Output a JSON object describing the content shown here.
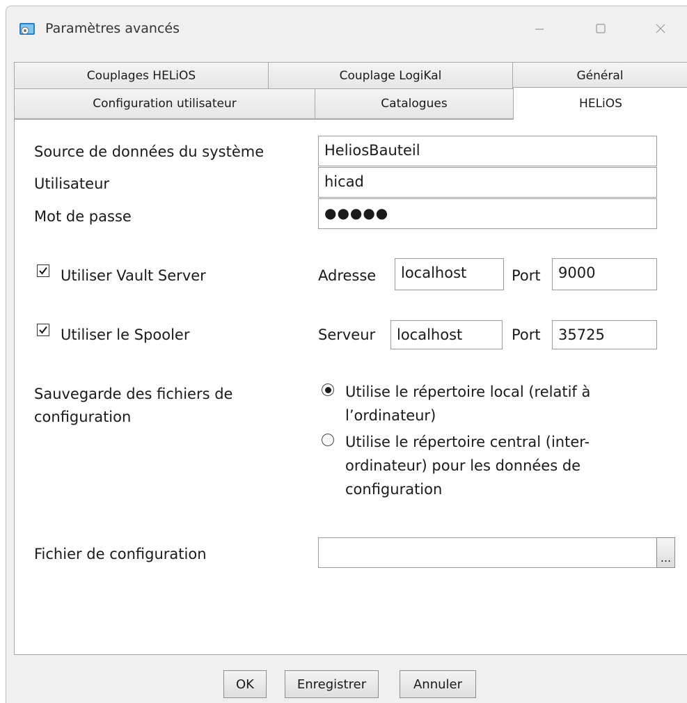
{
  "window": {
    "title": "Paramètres avancés",
    "icon": "settings-app-icon"
  },
  "tabs": {
    "row1": [
      {
        "label": "Couplages HELiOS"
      },
      {
        "label": "Couplage LogiKal"
      },
      {
        "label": "Général"
      }
    ],
    "row2": [
      {
        "label": "Configuration utilisateur"
      },
      {
        "label": "Catalogues"
      },
      {
        "label": "HELiOS",
        "active": true
      }
    ]
  },
  "form": {
    "datasource_label": "Source de données du système",
    "datasource_value": "HeliosBauteil",
    "user_label": "Utilisateur",
    "user_value": "hicad",
    "password_label": "Mot de passe",
    "password_value": "●●●●●",
    "vault": {
      "checked": true,
      "label": "Utiliser Vault Server",
      "address_label": "Adresse",
      "address_value": "localhost",
      "port_label": "Port",
      "port_value": "9000"
    },
    "spooler": {
      "checked": true,
      "label": "Utiliser le Spooler",
      "server_label": "Serveur",
      "server_value": "localhost",
      "port_label": "Port",
      "port_value": "35725"
    },
    "config_save_label_1": "Sauvegarde des fichiers de",
    "config_save_label_2": "configuration",
    "radio_local_1": "Utilise le répertoire local (relatif à",
    "radio_local_2": "l’ordinateur)",
    "radio_local_selected": true,
    "radio_central_1": "Utilise le répertoire central (inter-",
    "radio_central_2": "ordinateur) pour les données de",
    "radio_central_3": "configuration",
    "config_file_label": "Fichier de configuration",
    "config_file_value": "",
    "browse_label": "..."
  },
  "buttons": {
    "ok": "OK",
    "save": "Enregistrer",
    "cancel": "Annuler"
  }
}
